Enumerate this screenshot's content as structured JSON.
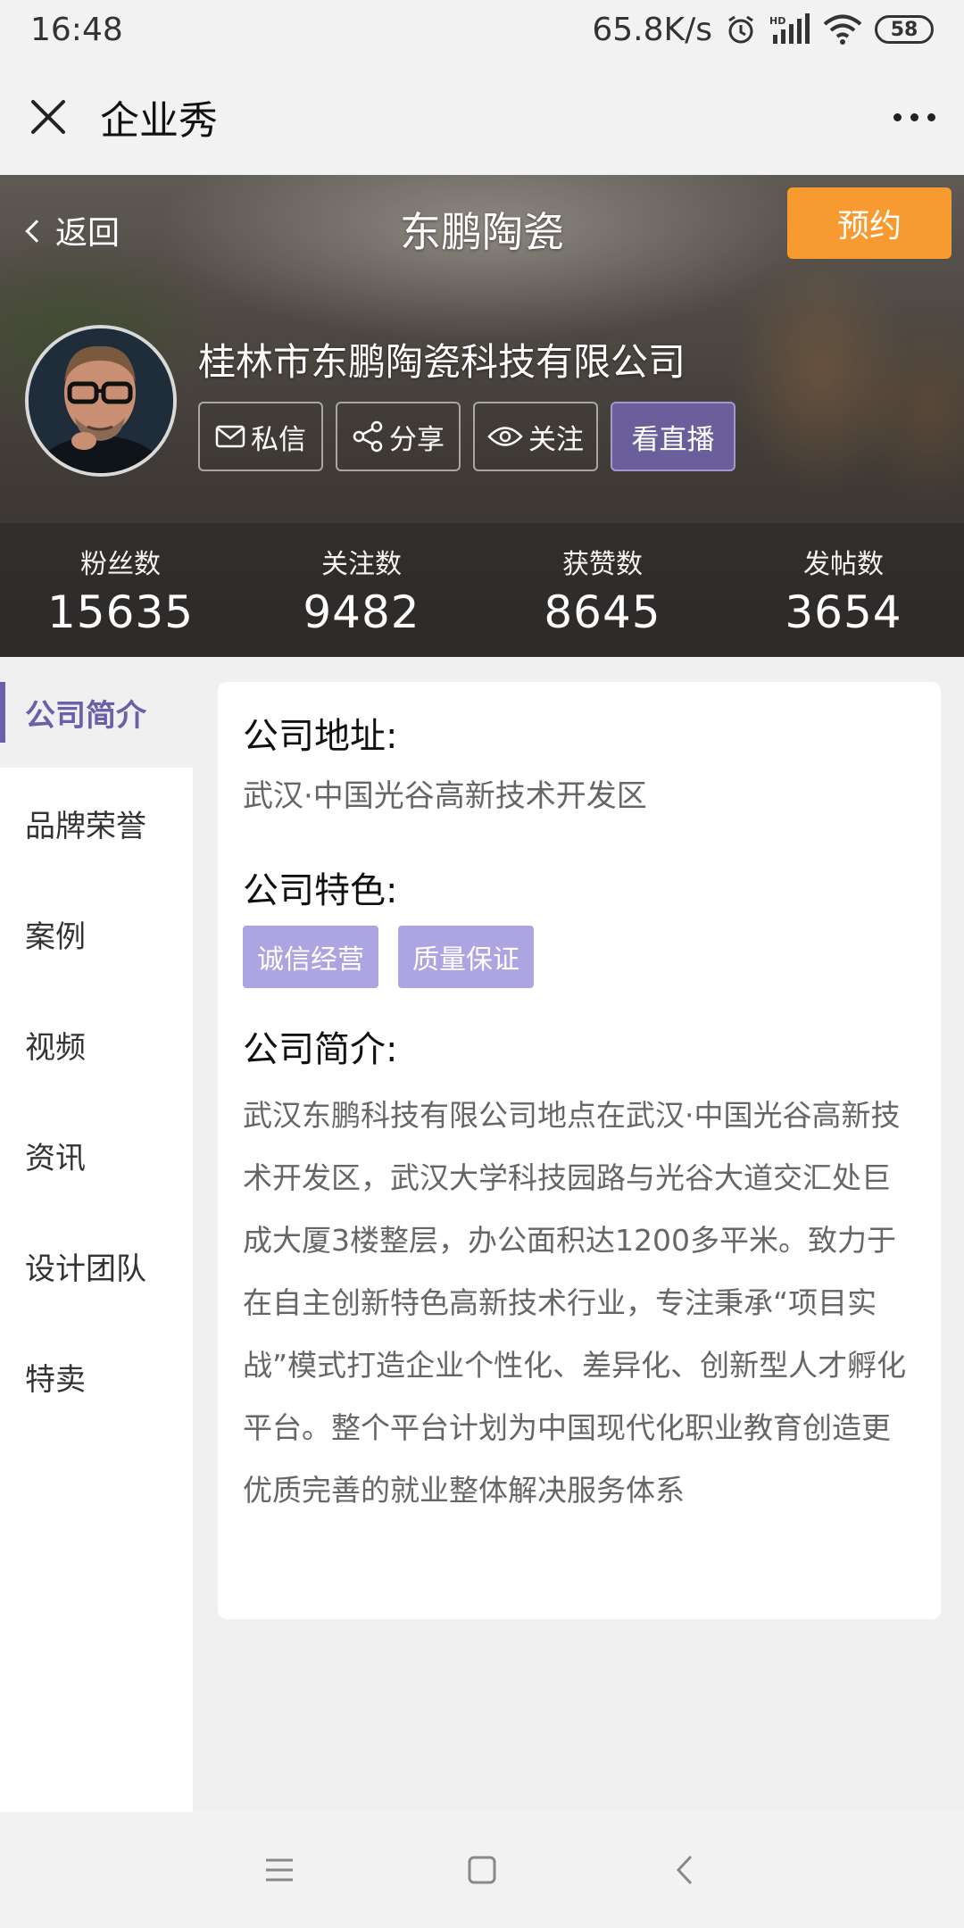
{
  "status_bar": {
    "time": "16:48",
    "speed": "65.8K/s",
    "battery": "58",
    "icons": [
      "alarm-icon",
      "hd-signal-icon",
      "wifi-icon",
      "battery-icon"
    ]
  },
  "app_header": {
    "title": "企业秀",
    "icons": [
      "close-icon",
      "more-icon"
    ]
  },
  "hero": {
    "back_label": "返回",
    "title": "东鹏陶瓷",
    "reserve_label": "预约",
    "company_name": "桂林市东鹏陶瓷科技有限公司",
    "actions": {
      "message": "私信",
      "share": "分享",
      "follow": "关注",
      "live": "看直播"
    },
    "stats": [
      {
        "label": "粉丝数",
        "value": "15635"
      },
      {
        "label": "关注数",
        "value": "9482"
      },
      {
        "label": "获赞数",
        "value": "8645"
      },
      {
        "label": "发帖数",
        "value": "3654"
      }
    ]
  },
  "sidebar": {
    "items": [
      {
        "label": "公司简介",
        "active": true
      },
      {
        "label": "品牌荣誉"
      },
      {
        "label": "案例"
      },
      {
        "label": "视频"
      },
      {
        "label": "资讯"
      },
      {
        "label": "设计团队"
      },
      {
        "label": "特卖"
      }
    ]
  },
  "content": {
    "address_title": "公司地址:",
    "address": "武汉·中国光谷高新技术开发区",
    "features_title": "公司特色:",
    "tags": [
      "诚信经营",
      "质量保证"
    ],
    "intro_title": "公司简介:",
    "intro": "武汉东鹏科技有限公司地点在武汉·中国光谷高新技术开发区，武汉大学科技园路与光谷大道交汇处巨成大厦3楼整层，办公面积达1200多平米。致力于在自主创新特色高新技术行业，专注秉承“项目实战”模式打造企业个性化、差异化、创新型人才孵化平台。整个平台计划为中国现代化职业教育创造更优质完善的就业整体解决服务体系"
  },
  "colors": {
    "accent": "#6a5fa8",
    "reserve": "#f79a30",
    "tag": "#ada5e2",
    "live_button": "#6a5f9a"
  }
}
